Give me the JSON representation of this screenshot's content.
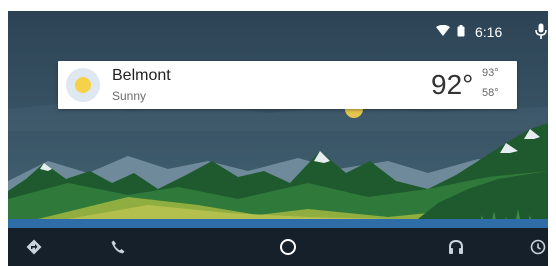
{
  "status_bar": {
    "time": "6:16",
    "icons": [
      "wifi-icon",
      "battery-icon",
      "mic-icon"
    ]
  },
  "weather_card": {
    "city": "Belmont",
    "condition": "Sunny",
    "temperature": "92°",
    "high": "93°",
    "low": "58°",
    "icon": "sun-icon"
  },
  "nav_bar": {
    "items": [
      "navigation-icon",
      "phone-icon",
      "home-icon",
      "headphones-icon",
      "notifications-icon"
    ]
  },
  "colors": {
    "sky": "#2b4254",
    "mountain": "#1f5a2e",
    "navbar": "#16202b",
    "accent_sun": "#f5d24a"
  }
}
